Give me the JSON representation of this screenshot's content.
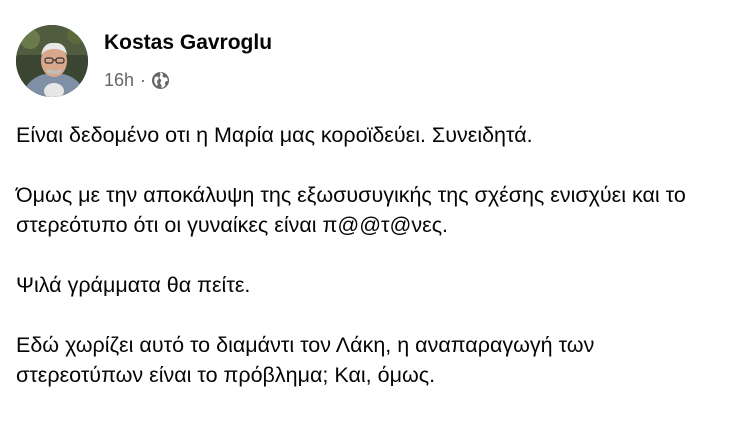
{
  "post": {
    "author": "Kostas Gavroglu",
    "time": "16h",
    "separator": "·",
    "privacy_icon": "globe-icon",
    "paragraphs": [
      "Είναι δεδομένο οτι η Μαρία μας κοροϊδεύει. Συνειδητά.",
      "Όμως με την αποκάλυψη της εξωσυσυγικής της σχέσης ενισχύει και το στερεότυπο ότι οι γυναίκες είναι π@@τ@νες.",
      "Ψιλά γράμματα θα πείτε.",
      "Εδώ χωρίζει αυτό το διαμάντι τον Λάκη, η αναπαραγωγή των στερεοτύπων είναι το πρόβλημα; Και, όμως."
    ]
  },
  "colors": {
    "text": "#050505",
    "secondary": "#65676b",
    "background": "#ffffff"
  }
}
